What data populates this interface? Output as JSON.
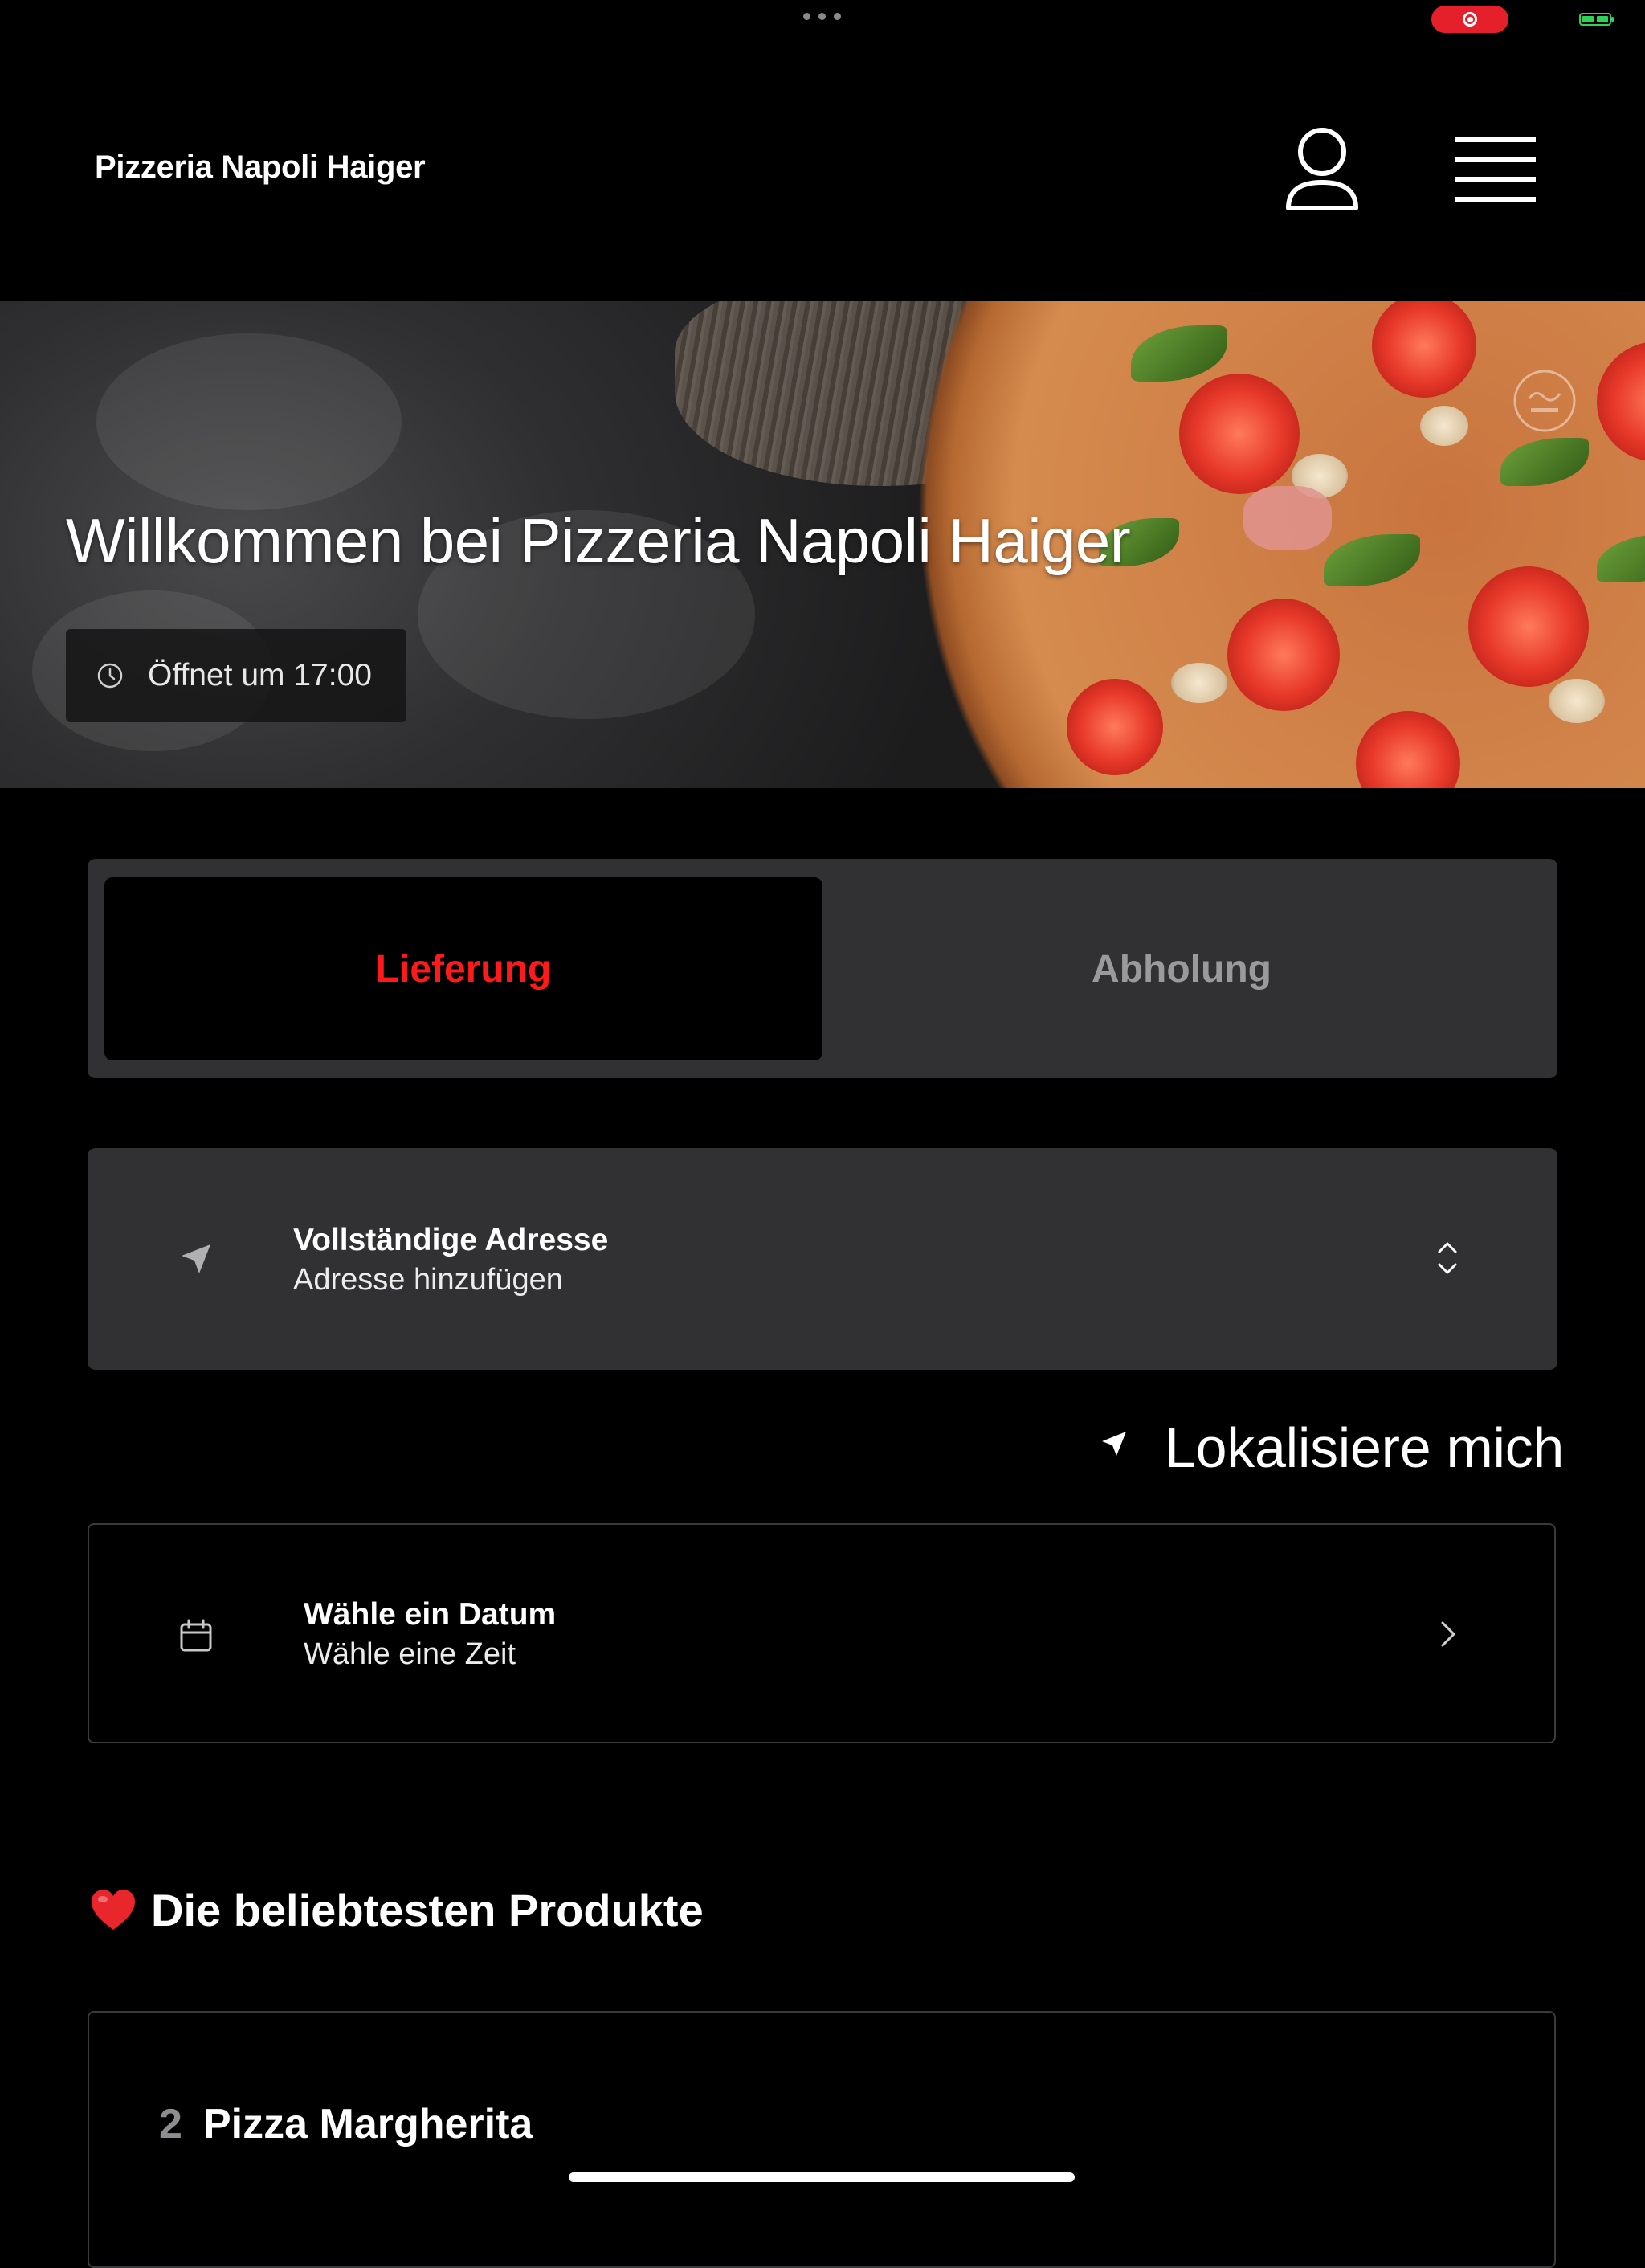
{
  "header": {
    "brand": "Pizzeria Napoli Haiger",
    "account_icon": "user-icon",
    "menu_icon": "menu-icon"
  },
  "hero": {
    "title": "Willkommen bei Pizzeria Napoli Haiger",
    "opening": "Öffnet um 17:00",
    "badge_icon": "halal-icon"
  },
  "order_mode": {
    "options": [
      "Lieferung",
      "Abholung"
    ],
    "selected": "Lieferung"
  },
  "address": {
    "title": "Vollständige Adresse",
    "subtitle": "Adresse hinzufügen"
  },
  "locate": {
    "label": "Lokalisiere mich"
  },
  "schedule": {
    "title": "Wähle ein Datum",
    "subtitle": "Wähle eine Zeit"
  },
  "popular": {
    "title": "Die beliebtesten Produkte",
    "products": [
      {
        "quantity": "2",
        "name": "Pizza Margherita"
      }
    ]
  },
  "colors": {
    "accent": "#ff1a1a",
    "card": "#313133",
    "background": "#000000"
  }
}
